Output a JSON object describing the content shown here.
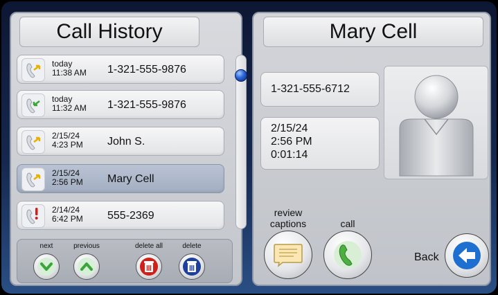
{
  "left": {
    "title": "Call History",
    "calls": [
      {
        "date": "today",
        "time": "11:38 AM",
        "name": "1-321-555-9876",
        "icon": "incoming-call-icon",
        "selected": false
      },
      {
        "date": "today",
        "time": "11:32 AM",
        "name": "1-321-555-9876",
        "icon": "outgoing-call-icon",
        "selected": false
      },
      {
        "date": "2/15/24",
        "time": "4:23 PM",
        "name": "John S.",
        "icon": "incoming-call-icon",
        "selected": false
      },
      {
        "date": "2/15/24",
        "time": "2:56 PM",
        "name": "Mary Cell",
        "icon": "incoming-call-icon",
        "selected": true
      },
      {
        "date": "2/14/24",
        "time": "6:42 PM",
        "name": "555-2369",
        "icon": "missed-call-icon",
        "selected": false
      }
    ],
    "actions": {
      "next": "next",
      "previous": "previous",
      "delete_all": "delete all",
      "delete": "delete"
    }
  },
  "right": {
    "title": "Mary Cell",
    "number": "1-321-555-6712",
    "date": "2/15/24",
    "time": "2:56 PM",
    "duration": "0:01:14",
    "review_captions": "review\ncaptions",
    "call": "call",
    "back": "Back"
  },
  "colors": {
    "accent_blue": "#1f6fd1",
    "delete_red": "#d0201a",
    "delete_blue": "#1d3f9e",
    "chevron_green": "#3aa63a",
    "phone_green": "#4bb040"
  }
}
